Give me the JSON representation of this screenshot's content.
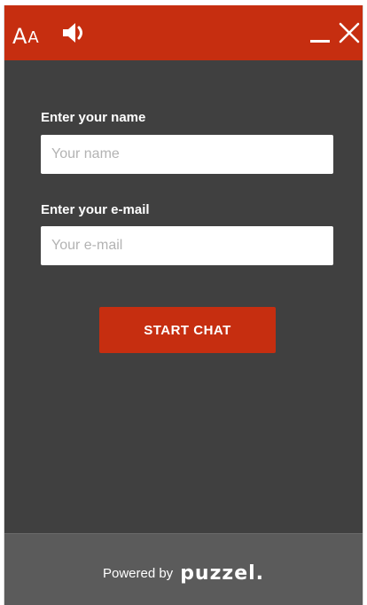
{
  "header": {
    "font_size_big": "A",
    "font_size_small": "A",
    "bg_color": "#c62e10"
  },
  "form": {
    "name_label": "Enter your name",
    "name_placeholder": "Your name",
    "name_value": "",
    "email_label": "Enter your e-mail",
    "email_placeholder": "Your e-mail",
    "email_value": "",
    "start_button": "START CHAT"
  },
  "footer": {
    "powered_by": "Powered by",
    "brand": "puzzel."
  },
  "icons": {
    "sound": "speaker-icon",
    "minimize": "minimize-icon",
    "close": "close-icon"
  },
  "colors": {
    "accent": "#c62e10",
    "body_bg": "#404040",
    "footer_bg": "#5b5b5b"
  }
}
